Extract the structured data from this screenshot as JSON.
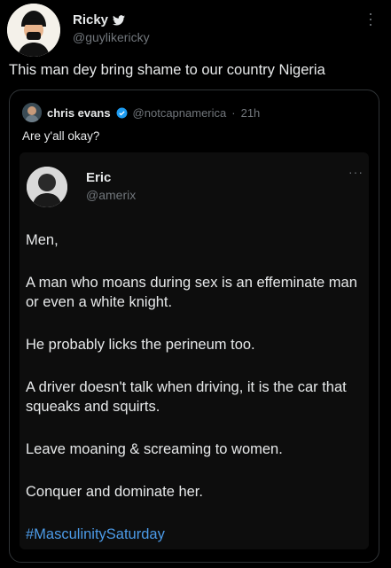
{
  "user": {
    "name": "Ricky",
    "handle": "@guylikericky"
  },
  "tweet": {
    "text": "This man dey bring shame to our country Nigeria"
  },
  "quoted": {
    "name": "chris evans",
    "handle": "@notcapnamerica",
    "time": "21h",
    "text": "Are y'all okay?"
  },
  "inner_post": {
    "name": "Eric",
    "handle": "@amerix",
    "more": "···",
    "lines": [
      "Men,",
      "A man who moans during sex is an effeminate man or even a white knight.",
      "He probably licks the perineum too.",
      "A driver doesn't talk when driving, it is the car that squeaks and squirts.",
      "Leave moaning & screaming to women.",
      "Conquer and dominate her."
    ],
    "hashtag": "#MasculinitySaturday"
  },
  "colors": {
    "accent": "#4c9be8",
    "verified": "#1d9bf0"
  }
}
